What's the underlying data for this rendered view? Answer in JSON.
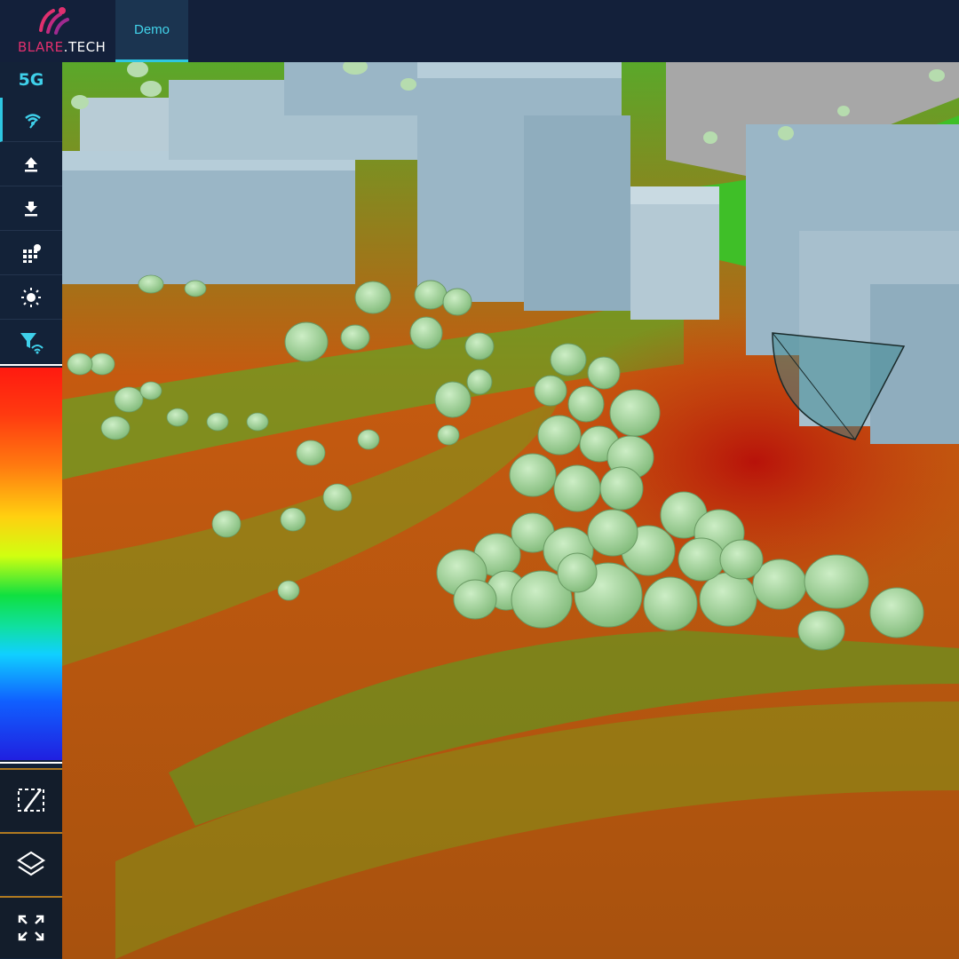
{
  "header": {
    "logo": {
      "text_brand": "BLARE",
      "text_dot": ".",
      "text_suffix": "TECH"
    },
    "tab": {
      "label": "Demo"
    }
  },
  "sidebar": {
    "network_label": "5G",
    "buttons": [
      {
        "icon": "signal-icon",
        "active": true
      },
      {
        "icon": "upload-icon"
      },
      {
        "icon": "download-icon"
      },
      {
        "icon": "grid-settings-icon"
      },
      {
        "icon": "brightness-icon"
      },
      {
        "icon": "signal-filter-icon"
      }
    ],
    "legend": {
      "colors": [
        "#ff1a10",
        "#ff7a10",
        "#ffd010",
        "#10e040",
        "#10d0ff",
        "#2020e0"
      ]
    },
    "bottom_buttons": [
      {
        "icon": "draw-area-icon"
      },
      {
        "icon": "layers-icon"
      },
      {
        "icon": "fullscreen-icon"
      }
    ]
  },
  "map": {
    "view": "3D coverage heatmap",
    "colors": {
      "high": "#c21a08",
      "mid": "#d07a10",
      "low": "#2fb82a",
      "building": "#9ab6c6",
      "tree": "#a8d8a0"
    }
  }
}
